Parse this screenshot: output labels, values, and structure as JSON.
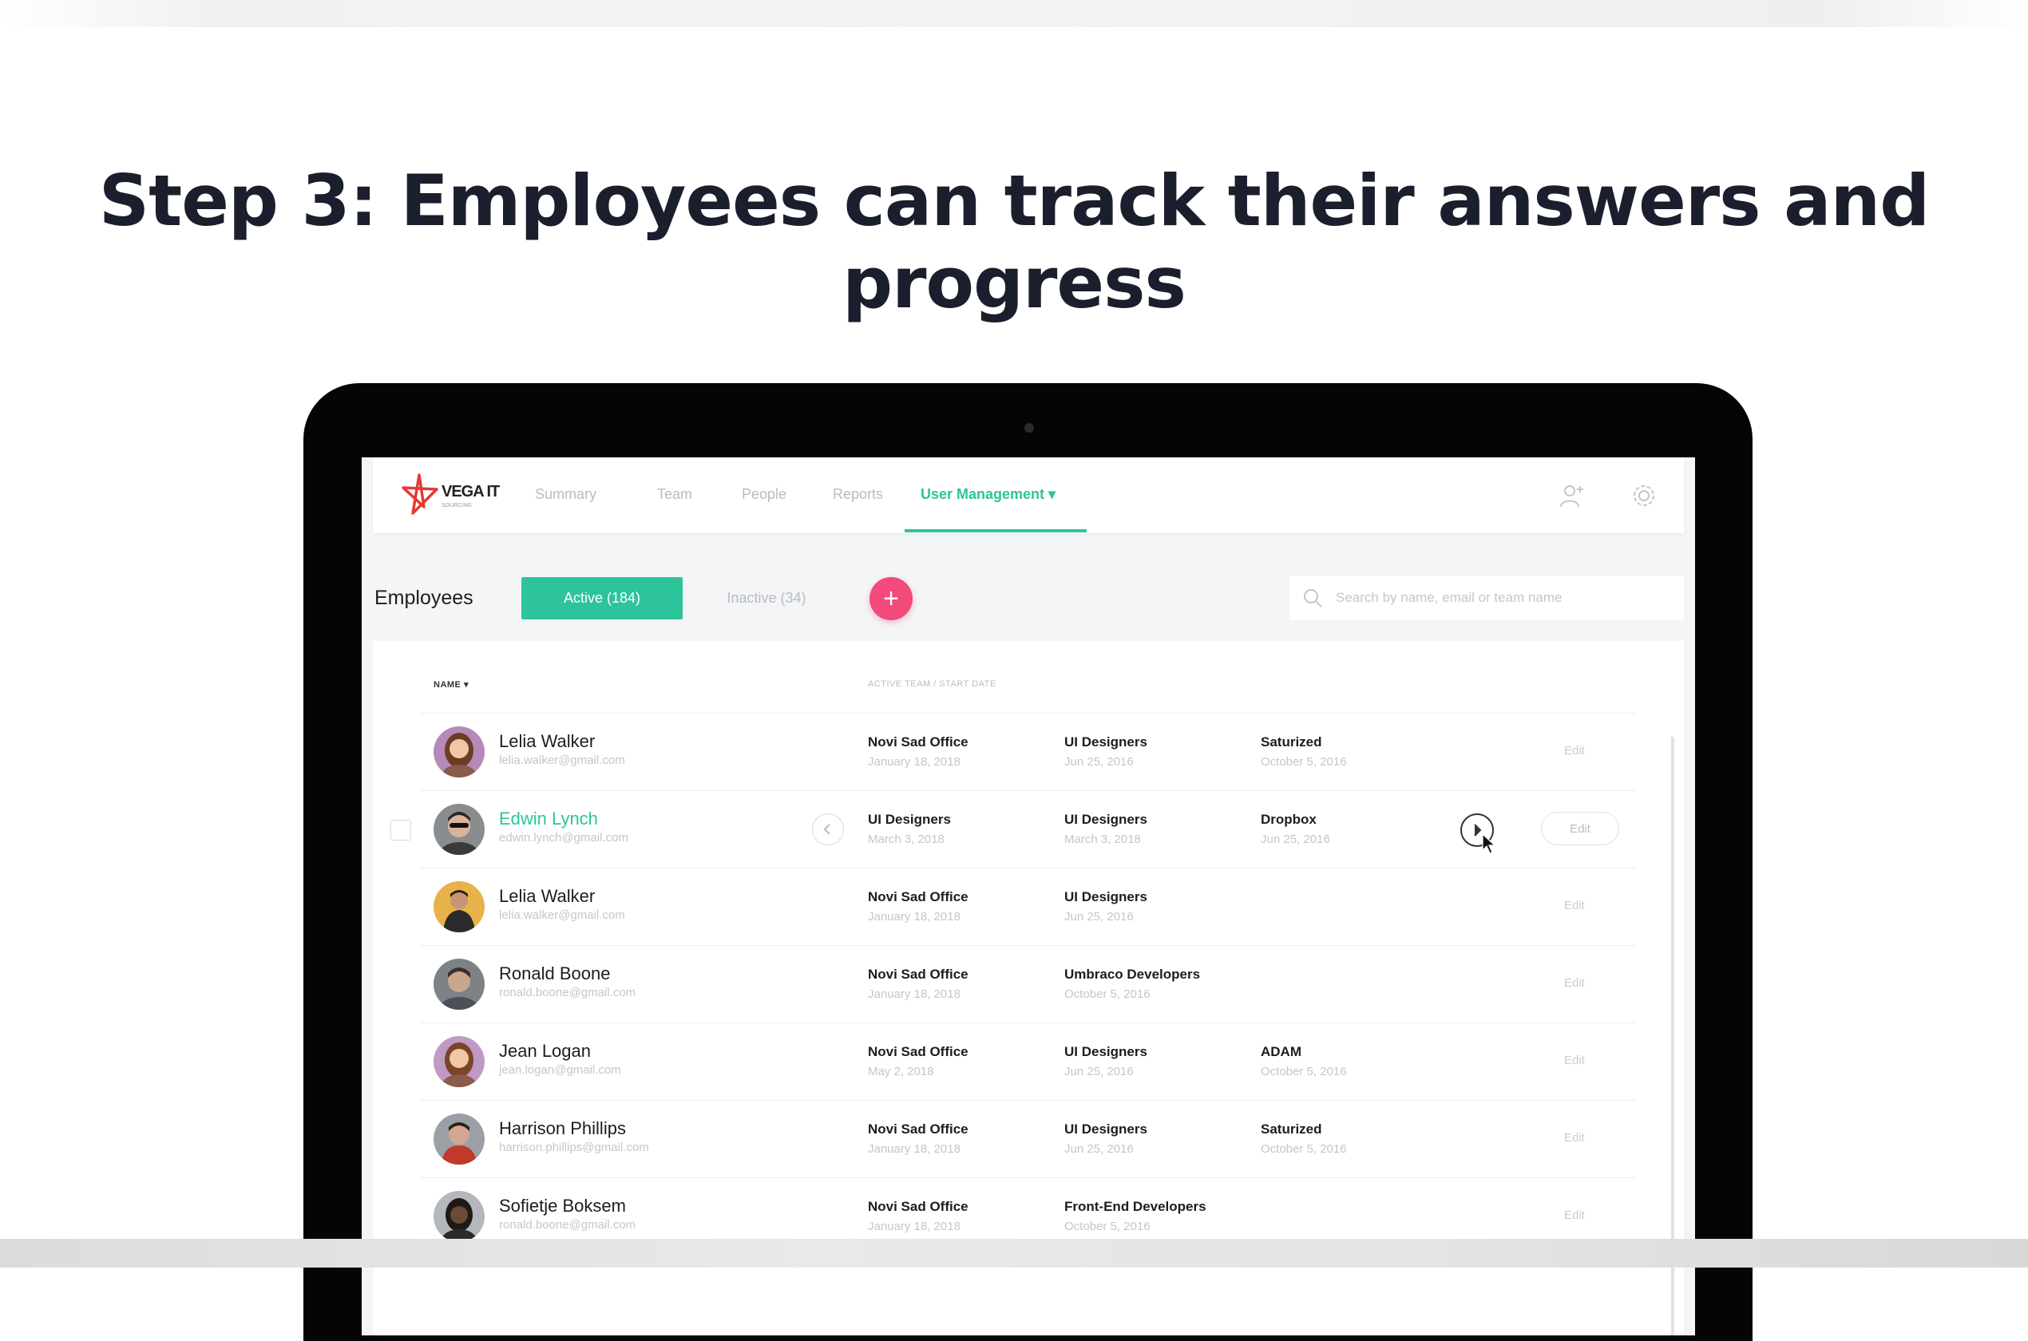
{
  "headline": "Step 3: Employees can track their answers and progress",
  "brand": {
    "name": "VEGA IT",
    "sub": "SOURCING",
    "accent": "#2dc49c",
    "pink": "#f24a7a"
  },
  "nav": {
    "items": [
      {
        "label": "Summary"
      },
      {
        "label": "Team"
      },
      {
        "label": "People"
      },
      {
        "label": "Reports"
      },
      {
        "label": "User Management ▾"
      }
    ],
    "icons": [
      "user-add-icon",
      "gear-icon"
    ]
  },
  "toolbar": {
    "title": "Employees",
    "tab_active": "Active (184)",
    "tab_inactive": "Inactive (34)",
    "add_label": "+",
    "search_placeholder": "Search by name, email or team name"
  },
  "table": {
    "col_name": "NAME ▾",
    "col_team": "ACTIVE TEAM / START DATE",
    "edit_label": "Edit",
    "rows": [
      {
        "name": "Lelia Walker",
        "email": "lelia.walker@gmail.com",
        "c1": "Novi Sad Office",
        "c1s": "January 18, 2018",
        "c2": "UI Designers",
        "c2s": "Jun 25, 2016",
        "c3": "Saturized",
        "c3s": "October 5, 2016",
        "avatar": "female-1"
      },
      {
        "name": "Edwin Lynch",
        "email": "edwin.lynch@gmail.com",
        "c1": "UI Designers",
        "c1s": "March 3, 2018",
        "c2": "UI Designers",
        "c2s": "March 3, 2018",
        "c3": "Dropbox",
        "c3s": "Jun 25, 2016",
        "avatar": "male-1"
      },
      {
        "name": "Lelia Walker",
        "email": "lelia.walker@gmail.com",
        "c1": "Novi Sad Office",
        "c1s": "January 18, 2018",
        "c2": "UI Designers",
        "c2s": "Jun 25, 2016",
        "c3": "",
        "c3s": "",
        "avatar": "male-2"
      },
      {
        "name": "Ronald Boone",
        "email": "ronald.boone@gmail.com",
        "c1": "Novi Sad Office",
        "c1s": "January 18, 2018",
        "c2": "Umbraco Developers",
        "c2s": "October 5, 2016",
        "c3": "",
        "c3s": "",
        "avatar": "male-3"
      },
      {
        "name": "Jean Logan",
        "email": "jean.logan@gmail.com",
        "c1": "Novi Sad Office",
        "c1s": "May 2, 2018",
        "c2": "UI Designers",
        "c2s": "Jun 25, 2016",
        "c3": "ADAM",
        "c3s": "October 5, 2016",
        "avatar": "female-1"
      },
      {
        "name": "Harrison Phillips",
        "email": "harrison.phillips@gmail.com",
        "c1": "Novi Sad Office",
        "c1s": "January 18, 2018",
        "c2": "UI Designers",
        "c2s": "Jun 25, 2016",
        "c3": "Saturized",
        "c3s": "October 5, 2016",
        "avatar": "male-4"
      },
      {
        "name": "Sofietje Boksem",
        "email": "ronald.boone@gmail.com",
        "c1": "Novi Sad Office",
        "c1s": "January 18, 2018",
        "c2": "Front-End Developers",
        "c2s": "October 5, 2016",
        "c3": "",
        "c3s": "",
        "avatar": "female-2"
      }
    ]
  }
}
